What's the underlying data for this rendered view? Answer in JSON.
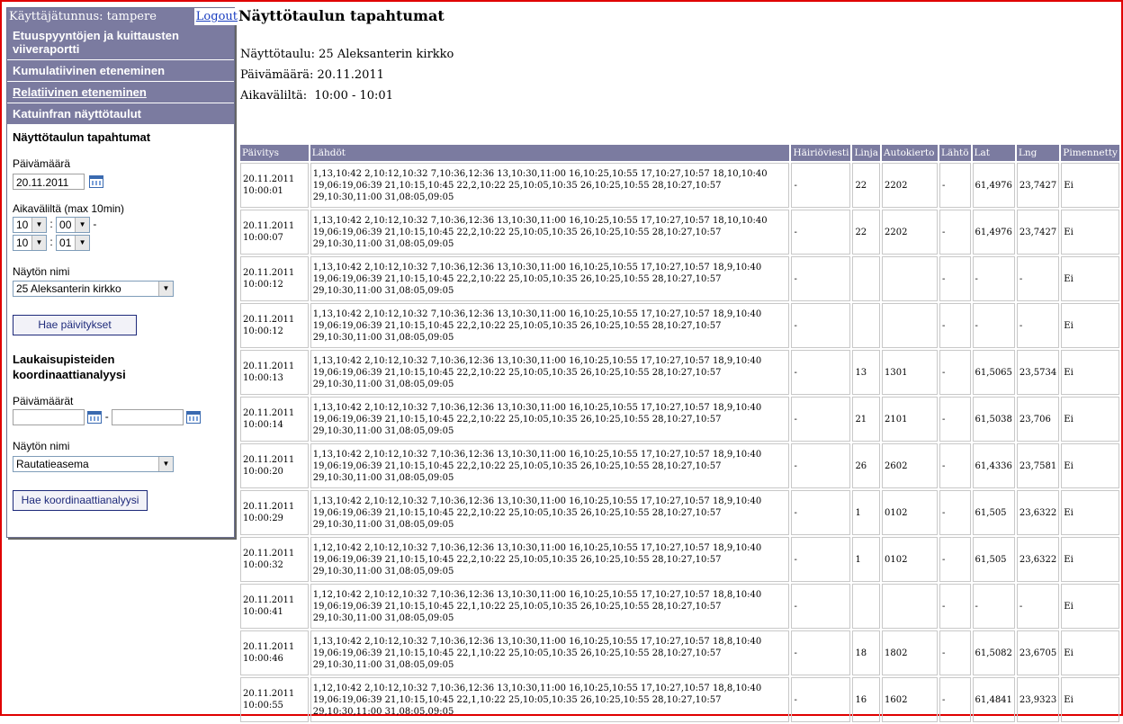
{
  "sidebar": {
    "user_label": "Käyttäjätunnus: tampere",
    "logout": "Logout",
    "nav": [
      "Etuuspyyntöjen ja kuittausten viiveraportti",
      "Kumulatiivinen eteneminen",
      "Relatiivinen eteneminen",
      "Katuinfran näyttötaulut"
    ],
    "events_section": {
      "title": "Näyttötaulun tapahtumat",
      "date_label": "Päivämäärä",
      "date_value": "20.11.2011",
      "interval_label": "Aikaväliltä (max 10min)",
      "from_hour": "10",
      "from_min": "00",
      "to_hour": "10",
      "to_min": "01",
      "display_label": "Näytön nimi",
      "display_value": "25 Aleksanterin kirkko",
      "button": "Hae päivitykset"
    },
    "coord_section": {
      "title": "Laukaisupisteiden koordinaattianalyysi",
      "dates_label": "Päivämäärät",
      "date_from": "",
      "date_to": "",
      "display_label": "Näytön nimi",
      "display_value": "Rautatieasema",
      "button": "Hae koordinaattianalyysi"
    }
  },
  "main": {
    "title": "Näyttötaulun tapahtumat",
    "board_label": "Näyttötaulu:",
    "board_value": "25 Aleksanterin kirkko",
    "date_label": "Päivämäärä:",
    "date_value": "20.11.2011",
    "interval_label": "Aikaväliltä:",
    "interval_value": "10:00 - 10:01"
  },
  "table": {
    "columns": [
      "Päivitys",
      "Lähdöt",
      "Häiriöviesti",
      "Linja",
      "Autokierto",
      "Lähtö",
      "Lat",
      "Lng",
      "Pimennetty"
    ],
    "rows": [
      {
        "date": "20.11.2011",
        "time": "10:00:01",
        "lahdot": "1,13,10:42 2,10:12,10:32 7,10:36,12:36 13,10:30,11:00 16,10:25,10:55 17,10:27,10:57 18,10,10:40 19,06:19,06:39 21,10:15,10:45 22,2,10:22 25,10:05,10:35 26,10:25,10:55 28,10:27,10:57 29,10:30,11:00 31,08:05,09:05",
        "hairio": "-",
        "linja": "22",
        "autokierto": "2202",
        "lahto": "-",
        "lat": "61,4976",
        "lng": "23,7427",
        "pim": "Ei"
      },
      {
        "date": "20.11.2011",
        "time": "10:00:07",
        "lahdot": "1,13,10:42 2,10:12,10:32 7,10:36,12:36 13,10:30,11:00 16,10:25,10:55 17,10:27,10:57 18,10,10:40 19,06:19,06:39 21,10:15,10:45 22,2,10:22 25,10:05,10:35 26,10:25,10:55 28,10:27,10:57 29,10:30,11:00 31,08:05,09:05",
        "hairio": "-",
        "linja": "22",
        "autokierto": "2202",
        "lahto": "-",
        "lat": "61,4976",
        "lng": "23,7427",
        "pim": "Ei"
      },
      {
        "date": "20.11.2011",
        "time": "10:00:12",
        "lahdot": "1,13,10:42 2,10:12,10:32 7,10:36,12:36 13,10:30,11:00 16,10:25,10:55 17,10:27,10:57 18,9,10:40 19,06:19,06:39 21,10:15,10:45 22,2,10:22 25,10:05,10:35 26,10:25,10:55 28,10:27,10:57 29,10:30,11:00 31,08:05,09:05",
        "hairio": "-",
        "linja": "",
        "autokierto": "",
        "lahto": "-",
        "lat": "-",
        "lng": "-",
        "pim": "Ei"
      },
      {
        "date": "20.11.2011",
        "time": "10:00:12",
        "lahdot": "1,13,10:42 2,10:12,10:32 7,10:36,12:36 13,10:30,11:00 16,10:25,10:55 17,10:27,10:57 18,9,10:40 19,06:19,06:39 21,10:15,10:45 22,2,10:22 25,10:05,10:35 26,10:25,10:55 28,10:27,10:57 29,10:30,11:00 31,08:05,09:05",
        "hairio": "-",
        "linja": "",
        "autokierto": "",
        "lahto": "-",
        "lat": "-",
        "lng": "-",
        "pim": "Ei"
      },
      {
        "date": "20.11.2011",
        "time": "10:00:13",
        "lahdot": "1,13,10:42 2,10:12,10:32 7,10:36,12:36 13,10:30,11:00 16,10:25,10:55 17,10:27,10:57 18,9,10:40 19,06:19,06:39 21,10:15,10:45 22,2,10:22 25,10:05,10:35 26,10:25,10:55 28,10:27,10:57 29,10:30,11:00 31,08:05,09:05",
        "hairio": "-",
        "linja": "13",
        "autokierto": "1301",
        "lahto": "-",
        "lat": "61,5065",
        "lng": "23,5734",
        "pim": "Ei"
      },
      {
        "date": "20.11.2011",
        "time": "10:00:14",
        "lahdot": "1,13,10:42 2,10:12,10:32 7,10:36,12:36 13,10:30,11:00 16,10:25,10:55 17,10:27,10:57 18,9,10:40 19,06:19,06:39 21,10:15,10:45 22,2,10:22 25,10:05,10:35 26,10:25,10:55 28,10:27,10:57 29,10:30,11:00 31,08:05,09:05",
        "hairio": "-",
        "linja": "21",
        "autokierto": "2101",
        "lahto": "-",
        "lat": "61,5038",
        "lng": "23,706",
        "pim": "Ei"
      },
      {
        "date": "20.11.2011",
        "time": "10:00:20",
        "lahdot": "1,13,10:42 2,10:12,10:32 7,10:36,12:36 13,10:30,11:00 16,10:25,10:55 17,10:27,10:57 18,9,10:40 19,06:19,06:39 21,10:15,10:45 22,2,10:22 25,10:05,10:35 26,10:25,10:55 28,10:27,10:57 29,10:30,11:00 31,08:05,09:05",
        "hairio": "-",
        "linja": "26",
        "autokierto": "2602",
        "lahto": "-",
        "lat": "61,4336",
        "lng": "23,7581",
        "pim": "Ei"
      },
      {
        "date": "20.11.2011",
        "time": "10:00:29",
        "lahdot": "1,13,10:42 2,10:12,10:32 7,10:36,12:36 13,10:30,11:00 16,10:25,10:55 17,10:27,10:57 18,9,10:40 19,06:19,06:39 21,10:15,10:45 22,2,10:22 25,10:05,10:35 26,10:25,10:55 28,10:27,10:57 29,10:30,11:00 31,08:05,09:05",
        "hairio": "-",
        "linja": "1",
        "autokierto": "0102",
        "lahto": "-",
        "lat": "61,505",
        "lng": "23,6322",
        "pim": "Ei"
      },
      {
        "date": "20.11.2011",
        "time": "10:00:32",
        "lahdot": "1,12,10:42 2,10:12,10:32 7,10:36,12:36 13,10:30,11:00 16,10:25,10:55 17,10:27,10:57 18,9,10:40 19,06:19,06:39 21,10:15,10:45 22,2,10:22 25,10:05,10:35 26,10:25,10:55 28,10:27,10:57 29,10:30,11:00 31,08:05,09:05",
        "hairio": "-",
        "linja": "1",
        "autokierto": "0102",
        "lahto": "-",
        "lat": "61,505",
        "lng": "23,6322",
        "pim": "Ei"
      },
      {
        "date": "20.11.2011",
        "time": "10:00:41",
        "lahdot": "1,12,10:42 2,10:12,10:32 7,10:36,12:36 13,10:30,11:00 16,10:25,10:55 17,10:27,10:57 18,8,10:40 19,06:19,06:39 21,10:15,10:45 22,1,10:22 25,10:05,10:35 26,10:25,10:55 28,10:27,10:57 29,10:30,11:00 31,08:05,09:05",
        "hairio": "-",
        "linja": "",
        "autokierto": "",
        "lahto": "-",
        "lat": "-",
        "lng": "-",
        "pim": "Ei"
      },
      {
        "date": "20.11.2011",
        "time": "10:00:46",
        "lahdot": "1,13,10:42 2,10:12,10:32 7,10:36,12:36 13,10:30,11:00 16,10:25,10:55 17,10:27,10:57 18,8,10:40 19,06:19,06:39 21,10:15,10:45 22,1,10:22 25,10:05,10:35 26,10:25,10:55 28,10:27,10:57 29,10:30,11:00 31,08:05,09:05",
        "hairio": "-",
        "linja": "18",
        "autokierto": "1802",
        "lahto": "-",
        "lat": "61,5082",
        "lng": "23,6705",
        "pim": "Ei"
      },
      {
        "date": "20.11.2011",
        "time": "10:00:55",
        "lahdot": "1,12,10:42 2,10:12,10:32 7,10:36,12:36 13,10:30,11:00 16,10:25,10:55 17,10:27,10:57 18,8,10:40 19,06:19,06:39 21,10:15,10:45 22,1,10:22 25,10:05,10:35 26,10:25,10:55 28,10:27,10:57 29,10:30,11:00 31,08:05,09:05",
        "hairio": "-",
        "linja": "16",
        "autokierto": "1602",
        "lahto": "-",
        "lat": "61,4841",
        "lng": "23,9323",
        "pim": "Ei"
      }
    ]
  }
}
